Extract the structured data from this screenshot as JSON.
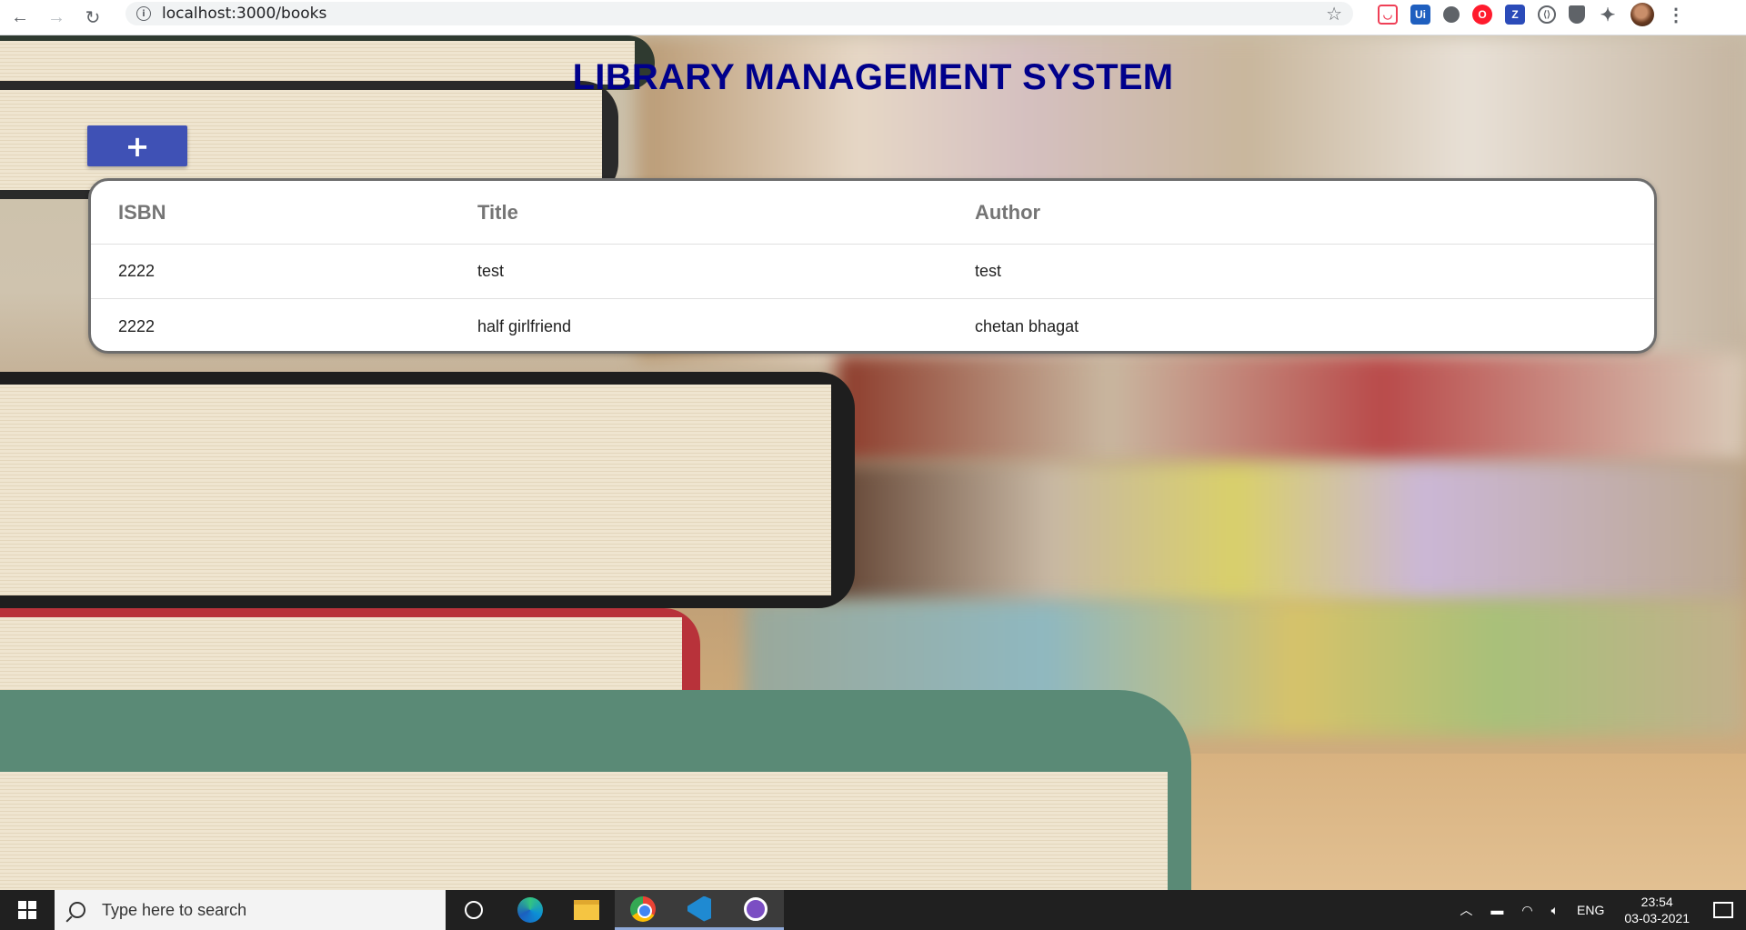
{
  "browser": {
    "url": "localhost:3000/books",
    "back_icon": "←",
    "forward_icon": "→",
    "reload_icon": "↻",
    "info_icon": "i",
    "star_icon": "☆",
    "extensions": [
      "pocket",
      "ui-path",
      "circle",
      "opera",
      "z",
      "code-brackets",
      "shield",
      "puzzle"
    ],
    "ext_labels": {
      "ui": "Ui",
      "z": "Z",
      "circ": "⟨⟩"
    },
    "menu_icon": "⋮"
  },
  "app": {
    "title": "LIBRARY MANAGEMENT SYSTEM",
    "add_button_label": "+",
    "table": {
      "headers": {
        "isbn": "ISBN",
        "title": "Title",
        "author": "Author"
      },
      "rows": [
        {
          "isbn": "2222",
          "title": "test",
          "author": "test"
        },
        {
          "isbn": "2222",
          "title": "half girlfriend",
          "author": "chetan bhagat"
        }
      ]
    },
    "colors": {
      "title": "#00008b",
      "button": "#3f51b5"
    }
  },
  "taskbar": {
    "search_placeholder": "Type here to search",
    "language": "ENG",
    "time": "23:54",
    "date": "03-03-2021"
  }
}
